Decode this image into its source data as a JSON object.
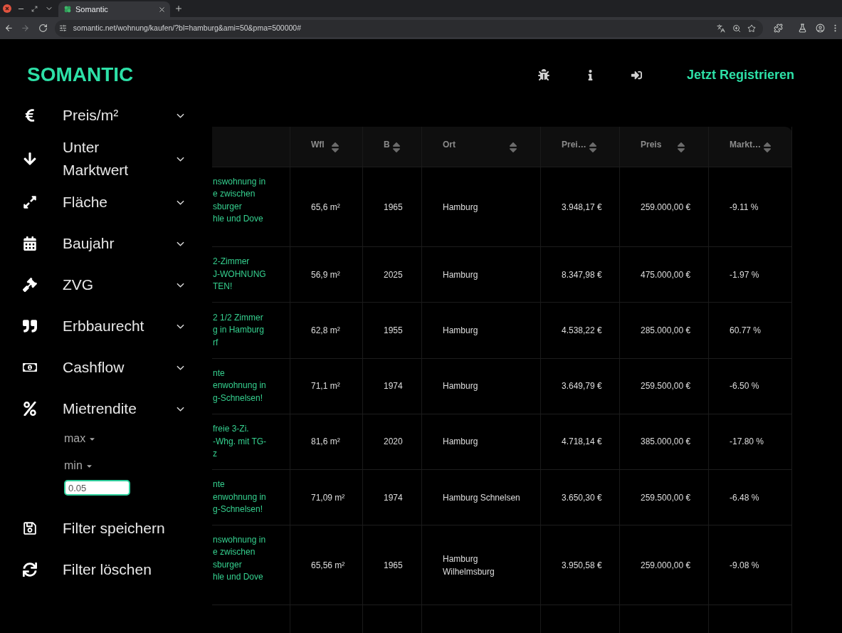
{
  "browser": {
    "tabs": [
      {
        "title": "Somantic",
        "selected": true
      }
    ],
    "url": "somantic.net/wohnung/kaufen/?bl=hamburg&ami=50&pma=500000#",
    "forward_disabled": true
  },
  "header": {
    "logo": "SOMANTIC",
    "register_link": "Jetzt Registrieren"
  },
  "sidebar": {
    "filters": [
      {
        "label": "Preis/m²"
      },
      {
        "label": "Unter Marktwert"
      },
      {
        "label": "Fläche"
      },
      {
        "label": "Baujahr"
      },
      {
        "label": "ZVG"
      },
      {
        "label": "Erbbaurecht"
      },
      {
        "label": "Cashflow"
      },
      {
        "label": "Mietrendite",
        "fields": [
          {
            "label": "max"
          },
          {
            "label": "min",
            "value": "0.05",
            "focused": true
          }
        ]
      }
    ],
    "actions": [
      {
        "label": "Filter speichern"
      },
      {
        "label": "Filter löschen"
      }
    ]
  },
  "table": {
    "columns": [
      {
        "label": "Wfl"
      },
      {
        "label": "B"
      },
      {
        "label": "Ort"
      },
      {
        "label": "Prei…"
      },
      {
        "label": "Preis"
      },
      {
        "label": "Markt…"
      }
    ],
    "rows": [
      {
        "title": "nswohnung in\ne zwischen\nsburger\nhle und Dove",
        "cells": [
          "65,6 m²",
          "1965",
          "Hamburg",
          "3.948,17 €",
          "259.000,00 €",
          "-9.11 %"
        ]
      },
      {
        "title": "2-Zimmer\nJ-WOHNUNG\nTEN!",
        "cells": [
          "56,9 m²",
          "2025",
          "Hamburg",
          "8.347,98 €",
          "475.000,00 €",
          "-1.97 %"
        ]
      },
      {
        "title": "2 1/2 Zimmer\ng in Hamburg\nrf",
        "cells": [
          "62,8 m²",
          "1955",
          "Hamburg",
          "4.538,22 €",
          "285.000,00 €",
          "60.77 %"
        ]
      },
      {
        "title": "nte\nenwohnung in\ng-Schnelsen!",
        "cells": [
          "71,1 m²",
          "1974",
          "Hamburg",
          "3.649,79 €",
          "259.500,00 €",
          "-6.50 %"
        ]
      },
      {
        "title": "freie 3-Zi.\n-Whg. mit TG-\nz",
        "cells": [
          "81,6 m²",
          "2020",
          "Hamburg",
          "4.718,14 €",
          "385.000,00 €",
          "-17.80 %"
        ]
      },
      {
        "title": "nte\nenwohnung in\ng-Schnelsen!",
        "cells": [
          "71,09 m²",
          "1974",
          "Hamburg Schnelsen",
          "3.650,30 €",
          "259.500,00 €",
          "-6.48 %"
        ]
      },
      {
        "title": "nswohnung in\ne zwischen\nsburger\nhle und Dove",
        "cells": [
          "65,56 m²",
          "1965",
          "Hamburg Wilhelmsburg",
          "3.950,58 €",
          "259.000,00 €",
          "-9.08 %"
        ]
      }
    ]
  }
}
